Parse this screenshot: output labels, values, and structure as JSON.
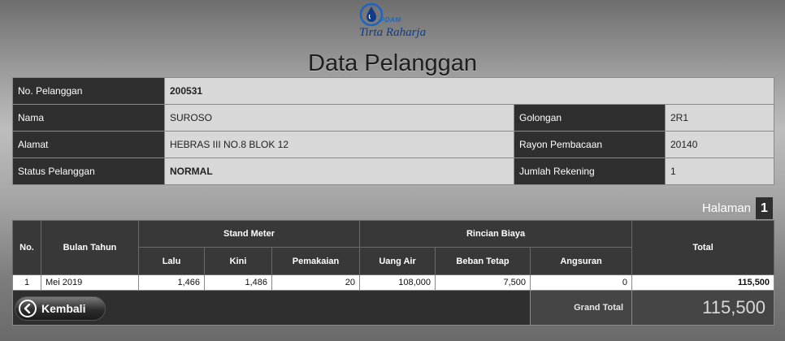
{
  "header": {
    "logo_small": "PDAM",
    "logo_name": "Tirta Raharja",
    "title": "Data Pelanggan"
  },
  "customer": {
    "no_label": "No. Pelanggan",
    "no_value": "200531",
    "nama_label": "Nama",
    "nama_value": "SUROSO",
    "golongan_label": "Golongan",
    "golongan_value": "2R1",
    "alamat_label": "Alamat",
    "alamat_value": "HEBRAS III NO.8 BLOK 12",
    "rayon_label": "Rayon Pembacaan",
    "rayon_value": "20140",
    "status_label": "Status Pelanggan",
    "status_value": "NORMAL",
    "jumlah_label": "Jumlah Rekening",
    "jumlah_value": "1"
  },
  "pagination": {
    "label": "Halaman",
    "page": "1"
  },
  "bills": {
    "headers": {
      "no": "No.",
      "bulan": "Bulan Tahun",
      "stand": "Stand Meter",
      "lalu": "Lalu",
      "kini": "Kini",
      "pemakaian": "Pemakaian",
      "rincian": "Rincian Biaya",
      "uang_air": "Uang Air",
      "beban": "Beban Tetap",
      "angsuran": "Angsuran",
      "total": "Total"
    },
    "rows": [
      {
        "no": "1",
        "bulan": "Mei 2019",
        "lalu": "1,466",
        "kini": "1,486",
        "pemakaian": "20",
        "uang_air": "108,000",
        "beban": "7,500",
        "angsuran": "0",
        "total": "115,500"
      }
    ],
    "grand_total_label": "Grand Total",
    "grand_total_value": "115,500"
  },
  "actions": {
    "back_label": "Kembali"
  },
  "colors": {
    "brand": "#0d3c8a",
    "header_dark": "#2f2f2f",
    "cell_light": "#d8d8d8"
  },
  "icons": {
    "logo": "water-drop-icon",
    "back": "arrow-left-icon"
  }
}
